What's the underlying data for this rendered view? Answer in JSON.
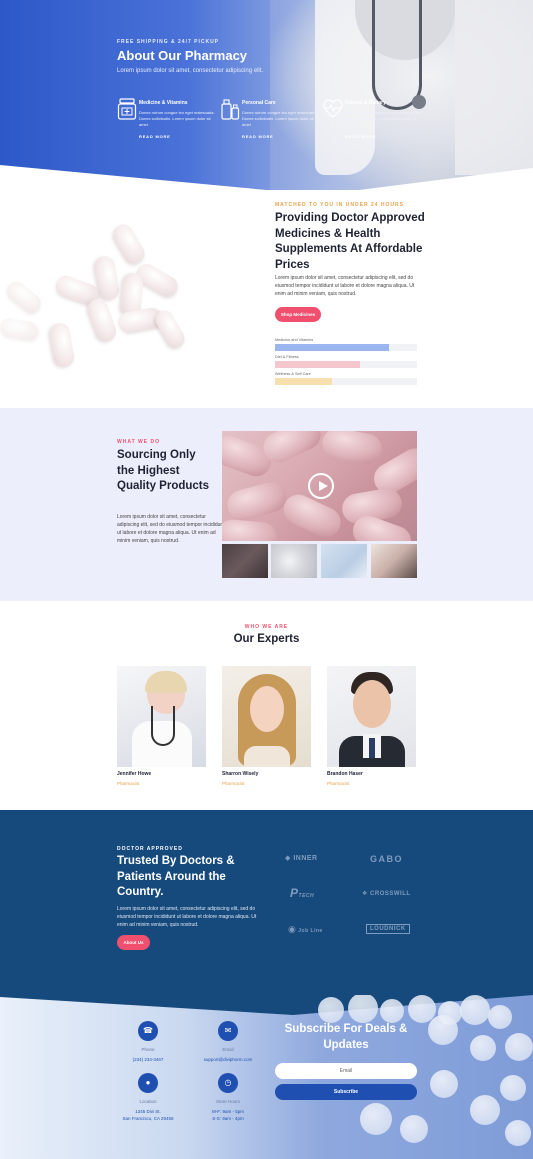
{
  "hero": {
    "eyebrow": "FREE SHIPPING & 24/7 PICKUP",
    "title": "About Our Pharmacy",
    "subtitle": "Lorem ipsum dolor sit amet, consectetur adipiscing elit.",
    "features": [
      {
        "icon": "medicine-bottle-icon",
        "title": "Medicine & Vitamins",
        "desc": "Donec rutrum congue leo eget malesuada. Donec sollicitudin. Lorem ipsum dolor sit amet",
        "link": "READ MORE"
      },
      {
        "icon": "supplement-bottles-icon",
        "title": "Personal Care",
        "desc": "Donec rutrum congue leo eget malesuada. Donec sollicitudin. Lorem ipsum dolor sit amet",
        "link": "READ MORE"
      },
      {
        "icon": "heart-pulse-icon",
        "title": "Fitness & Dietary",
        "desc": "Donec rutrum congue leo eget malesuada. Donec sollicitudin. Lorem ipsum dolor sit amet",
        "link": "READ MORE"
      }
    ]
  },
  "providing": {
    "eyebrow": "MATCHED TO YOU IN UNDER 24 HOURS",
    "title": "Providing Doctor Approved Medicines & Health Supplements At Affordable Prices",
    "body": "Lorem ipsum dolor sit amet, consectetur adipiscing elit, sed do eiusmod tempor incididunt ut labore et dolore magna aliqua. Ut enim ad minim veniam, quis nostrud.",
    "button": "Shop Medicines",
    "bars": [
      {
        "label": "Medicine and Vitamins",
        "value": 0.8,
        "color": "#9bb6ee"
      },
      {
        "label": "Diet & Fitness",
        "value": 0.6,
        "color": "#f4c7cf"
      },
      {
        "label": "Wellness & Self Care",
        "value": 0.4,
        "color": "#f8dfb0"
      }
    ]
  },
  "sourcing": {
    "eyebrow": "WHAT WE DO",
    "title": "Sourcing Only the Highest Quality Products",
    "body": "Lorem ipsum dolor sit amet, consectetur adipiscing elit, sed do eiusmod tempor incididunt ut labore et dolore magna aliqua. Ut enim ad minim veniam, quis nostrud."
  },
  "experts": {
    "eyebrow": "WHO WE ARE",
    "title": "Our Experts",
    "people": [
      {
        "name": "Jennifer Howe",
        "role": "Pharmacist"
      },
      {
        "name": "Sharron Wisely",
        "role": "Pharmacist"
      },
      {
        "name": "Brandon Haser",
        "role": "Pharmacist"
      }
    ]
  },
  "trusted": {
    "eyebrow": "DOCTOR APPROVED",
    "title": "Trusted By Doctors & Patients Around the Country.",
    "body": "Lorem ipsum dolor sit amet, consectetur adipiscing elit, sed do eiusmod tempor incididunt ut labore et dolore magna aliqua. Ut enim ad minim veniam, quis nostrud.",
    "button": "About Us",
    "logos": [
      "INNER",
      "GABO",
      "TECH",
      "CROSSWILL",
      "Job Line",
      "LOUDNICK"
    ]
  },
  "contact": {
    "items": [
      {
        "icon": "phone-icon",
        "label": "Phone",
        "value": "(234) 234-3467"
      },
      {
        "icon": "email-icon",
        "label": "Email",
        "value": "support@diviphorm.com"
      },
      {
        "icon": "location-icon",
        "label": "Location",
        "value": "1345 Divi St.\nSan Francisco, CA 29456"
      },
      {
        "icon": "clock-icon",
        "label": "Store Hours",
        "value": "M-F: 9am - 5pm\nS-S: 9am - 4pm"
      }
    ],
    "subscribe_title": "Subscribe For Deals & Updates",
    "email_placeholder": "Email",
    "subscribe_button": "Subscribe"
  },
  "colors": {
    "primary_blue": "#1f4fb0",
    "navy": "#174a7c",
    "pink": "#f0506e",
    "orange": "#e8a24a"
  }
}
